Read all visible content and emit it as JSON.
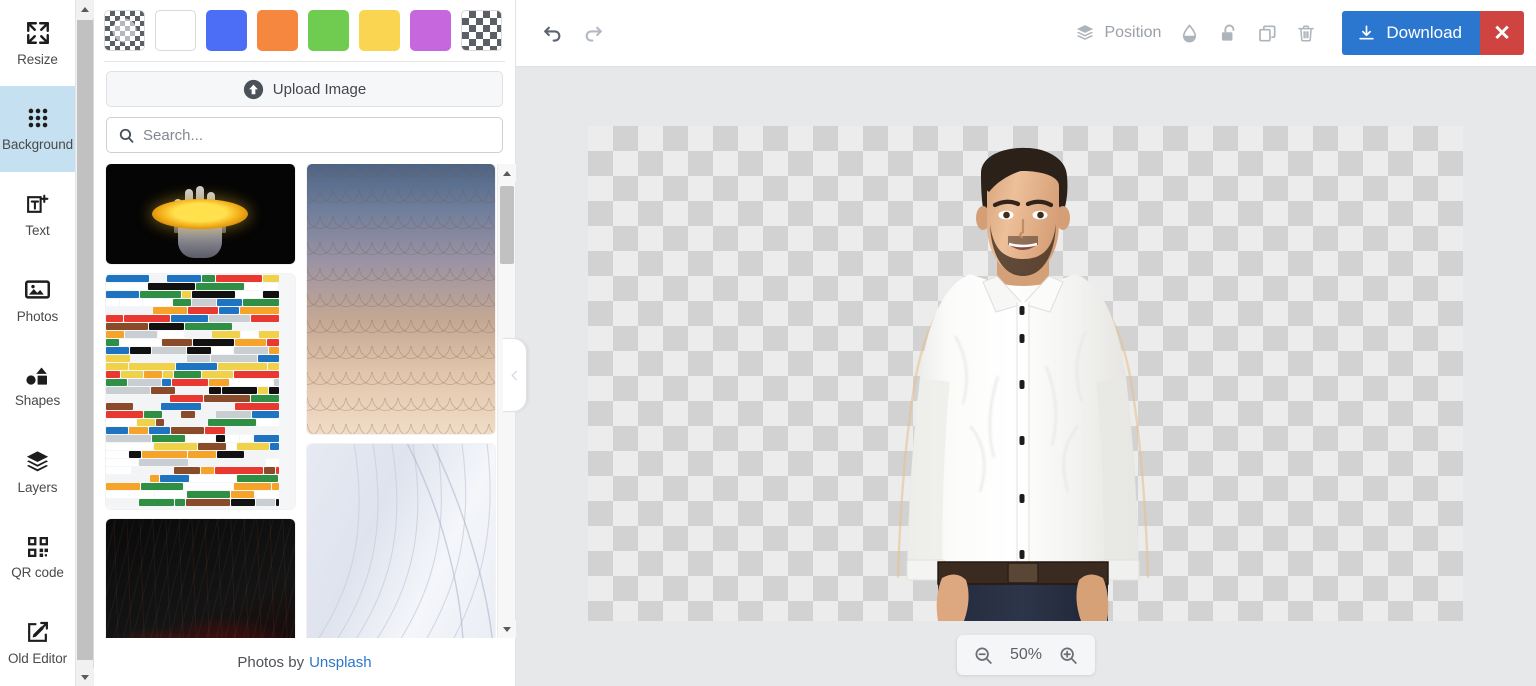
{
  "sidebar": {
    "items": [
      {
        "label": "Resize",
        "icon": "resize-icon",
        "active": false
      },
      {
        "label": "Background",
        "icon": "grid-dots-icon",
        "active": true
      },
      {
        "label": "Text",
        "icon": "add-text-icon",
        "active": false
      },
      {
        "label": "Photos",
        "icon": "photo-icon",
        "active": false
      },
      {
        "label": "Shapes",
        "icon": "shapes-icon",
        "active": false
      },
      {
        "label": "Layers",
        "icon": "layers-icon",
        "active": false
      },
      {
        "label": "QR code",
        "icon": "qr-code-icon",
        "active": false
      },
      {
        "label": "Old Editor",
        "icon": "edit-square-icon",
        "active": false
      }
    ]
  },
  "panel": {
    "swatches": [
      {
        "name": "transparent-selected",
        "color": "transparent",
        "type": "checker",
        "selected": true
      },
      {
        "name": "white",
        "color": "#ffffff",
        "type": "solid",
        "selected": false
      },
      {
        "name": "blue",
        "color": "#4c6ef7",
        "type": "solid",
        "selected": false
      },
      {
        "name": "orange",
        "color": "#f5873f",
        "type": "solid",
        "selected": false
      },
      {
        "name": "green",
        "color": "#6fcc50",
        "type": "solid",
        "selected": false
      },
      {
        "name": "yellow",
        "color": "#fad551",
        "type": "solid",
        "selected": false
      },
      {
        "name": "purple",
        "color": "#c濃",
        "type": "solid",
        "selected": false
      },
      {
        "name": "transparent",
        "color": "transparent",
        "type": "checker",
        "selected": false
      }
    ],
    "upload_label": "Upload Image",
    "upload_icon": "upload-arrow-icon",
    "search_placeholder": "Search...",
    "search_value": "",
    "search_icon": "search-icon",
    "footer_text": "Photos by",
    "footer_link": "Unsplash",
    "gallery": {
      "left_column": [
        {
          "name": "hand-saturn-thumbnail",
          "art": "hand"
        },
        {
          "name": "color-blocks-thumbnail",
          "art": "blocks"
        },
        {
          "name": "red-smoke-thumbnail",
          "art": "red"
        }
      ],
      "right_column": [
        {
          "name": "scales-pattern-thumbnail",
          "art": "scales"
        },
        {
          "name": "white-waves-thumbnail",
          "art": "waves"
        }
      ]
    }
  },
  "topbar": {
    "undo": {
      "name": "undo-icon",
      "enabled": true
    },
    "redo": {
      "name": "redo-icon",
      "enabled": false
    },
    "position_label": "Position",
    "position_icon": "layers-stack-icon",
    "tools": [
      {
        "name": "opacity-droplet-icon"
      },
      {
        "name": "unlock-icon"
      },
      {
        "name": "duplicate-icon"
      },
      {
        "name": "delete-trash-icon"
      }
    ],
    "download_label": "Download",
    "download_icon": "download-icon",
    "download_color": "#2b77d0",
    "close_label": "✕",
    "close_color": "#cf4440"
  },
  "canvas": {
    "subject_alt": "man-in-white-shirt-cutout",
    "background": "transparent-checkerboard",
    "zoom": {
      "level": "50%",
      "zoom_out_icon": "zoom-out-icon",
      "zoom_in_icon": "zoom-in-icon"
    }
  }
}
